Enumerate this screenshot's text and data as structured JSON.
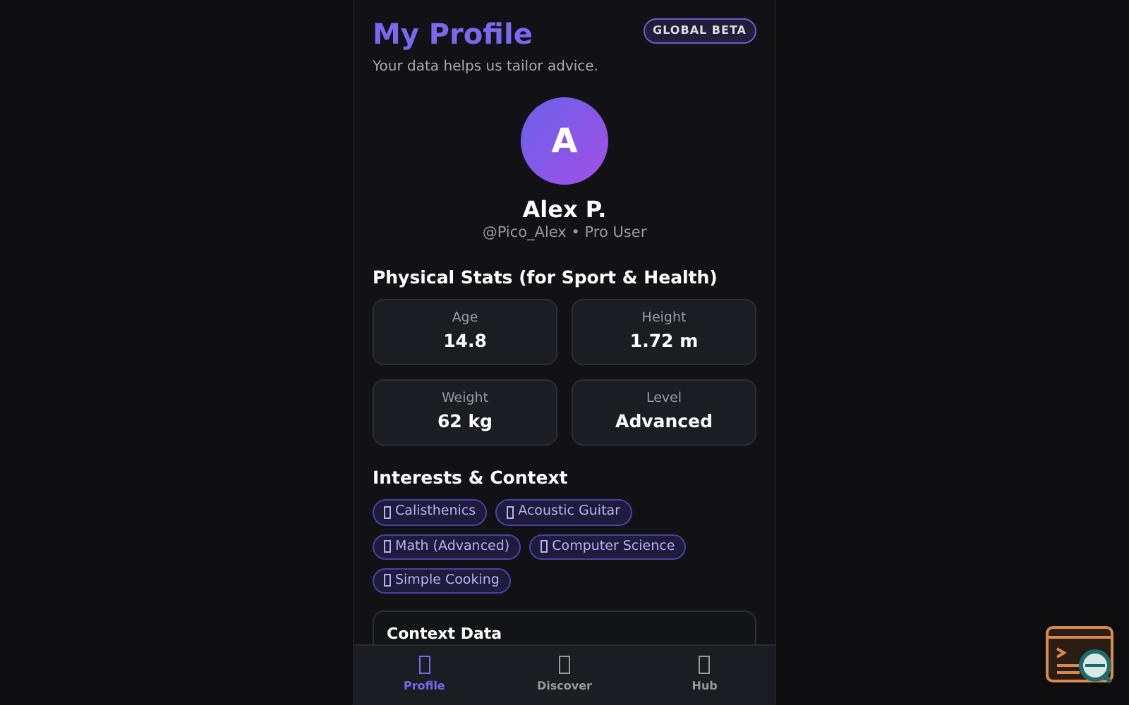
{
  "header": {
    "title": "My Profile",
    "badge": "GLOBAL BETA",
    "subtitle": "Your data helps us tailor advice."
  },
  "profile": {
    "initial": "A",
    "name": "Alex P.",
    "handle": "@Pico_Alex • Pro User"
  },
  "stats": {
    "heading": "Physical Stats (for Sport & Health)",
    "items": [
      {
        "label": "Age",
        "value": "14.8"
      },
      {
        "label": "Height",
        "value": "1.72 m"
      },
      {
        "label": "Weight",
        "value": "62 kg"
      },
      {
        "label": "Level",
        "value": "Advanced"
      }
    ]
  },
  "interests": {
    "heading": "Interests & Context",
    "tags": [
      {
        "label": "Calisthenics"
      },
      {
        "label": "Acoustic Guitar"
      },
      {
        "label": "Math (Advanced)"
      },
      {
        "label": "Computer Science"
      },
      {
        "label": "Simple Cooking"
      }
    ]
  },
  "context_card": {
    "title": "Context Data"
  },
  "nav": [
    {
      "label": "Profile",
      "selected": true
    },
    {
      "label": "Discover",
      "selected": false
    },
    {
      "label": "Hub",
      "selected": false
    }
  ]
}
